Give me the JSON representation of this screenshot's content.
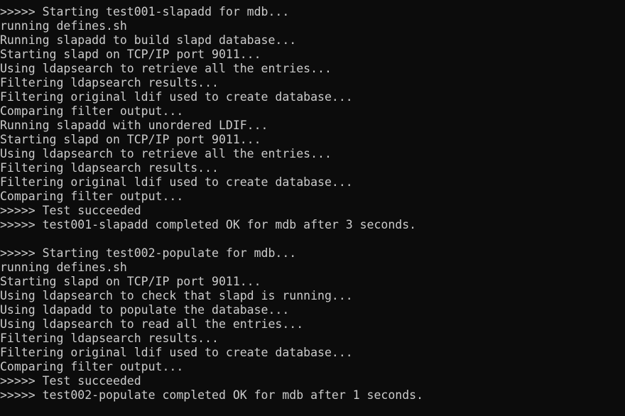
{
  "terminal": {
    "lines": [
      ">>>>> Starting test001-slapadd for mdb...",
      "running defines.sh",
      "Running slapadd to build slapd database...",
      "Starting slapd on TCP/IP port 9011...",
      "Using ldapsearch to retrieve all the entries...",
      "Filtering ldapsearch results...",
      "Filtering original ldif used to create database...",
      "Comparing filter output...",
      "Running slapadd with unordered LDIF...",
      "Starting slapd on TCP/IP port 9011...",
      "Using ldapsearch to retrieve all the entries...",
      "Filtering ldapsearch results...",
      "Filtering original ldif used to create database...",
      "Comparing filter output...",
      ">>>>> Test succeeded",
      ">>>>> test001-slapadd completed OK for mdb after 3 seconds.",
      "",
      ">>>>> Starting test002-populate for mdb...",
      "running defines.sh",
      "Starting slapd on TCP/IP port 9011...",
      "Using ldapsearch to check that slapd is running...",
      "Using ldapadd to populate the database...",
      "Using ldapsearch to read all the entries...",
      "Filtering ldapsearch results...",
      "Filtering original ldif used to create database...",
      "Comparing filter output...",
      ">>>>> Test succeeded",
      ">>>>> test002-populate completed OK for mdb after 1 seconds."
    ]
  }
}
